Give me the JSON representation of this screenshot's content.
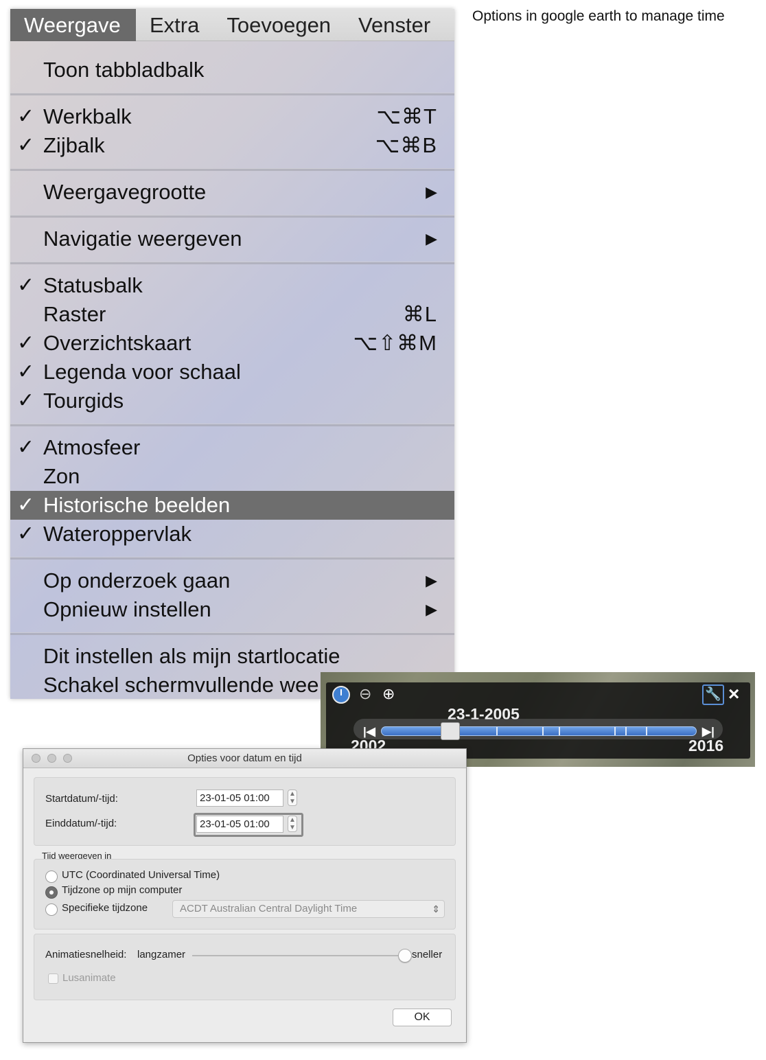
{
  "caption": "Options in google earth to manage time",
  "menubar": {
    "items": [
      "Weergave",
      "Extra",
      "Toevoegen",
      "Venster"
    ],
    "active_index": 0
  },
  "menu": {
    "check_glyph": "✓",
    "submenu_glyph": "▶",
    "items": [
      {
        "label": "Toon tabbladbalk",
        "checked": false,
        "shortcut": "",
        "submenu": false
      },
      {
        "label": "Werkbalk",
        "checked": true,
        "shortcut": "⌥⌘T",
        "submenu": false
      },
      {
        "label": "Zijbalk",
        "checked": true,
        "shortcut": "⌥⌘B",
        "submenu": false
      },
      {
        "label": "Weergavegrootte",
        "checked": false,
        "shortcut": "",
        "submenu": true
      },
      {
        "label": "Navigatie weergeven",
        "checked": false,
        "shortcut": "",
        "submenu": true
      },
      {
        "label": "Statusbalk",
        "checked": true,
        "shortcut": "",
        "submenu": false
      },
      {
        "label": "Raster",
        "checked": false,
        "shortcut": "⌘L",
        "submenu": false
      },
      {
        "label": "Overzichtskaart",
        "checked": true,
        "shortcut": "⌥⇧⌘M",
        "submenu": false
      },
      {
        "label": "Legenda voor schaal",
        "checked": true,
        "shortcut": "",
        "submenu": false
      },
      {
        "label": "Tourgids",
        "checked": true,
        "shortcut": "",
        "submenu": false
      },
      {
        "label": "Atmosfeer",
        "checked": true,
        "shortcut": "",
        "submenu": false
      },
      {
        "label": "Zon",
        "checked": false,
        "shortcut": "",
        "submenu": false
      },
      {
        "label": "Historische beelden",
        "checked": true,
        "shortcut": "",
        "submenu": false,
        "selected": true
      },
      {
        "label": "Wateroppervlak",
        "checked": true,
        "shortcut": "",
        "submenu": false
      },
      {
        "label": "Op onderzoek gaan",
        "checked": false,
        "shortcut": "",
        "submenu": true
      },
      {
        "label": "Opnieuw instellen",
        "checked": false,
        "shortcut": "",
        "submenu": true
      },
      {
        "label": "Dit instellen als mijn startlocatie",
        "checked": false,
        "shortcut": "",
        "submenu": false
      },
      {
        "label": "Schakel schermvullende wee",
        "checked": false,
        "shortcut": "",
        "submenu": false
      }
    ]
  },
  "timeline": {
    "current_date": "23-1-2005",
    "start_year": "2002",
    "end_year": "2016",
    "position_fraction": 0.22,
    "icons": {
      "clock": "clock-icon",
      "zoom_out": "zoom-out-icon",
      "zoom_in": "zoom-in-icon",
      "settings": "wrench-icon",
      "close": "close-icon",
      "prev": "skip-back-icon",
      "next": "skip-forward-icon"
    },
    "zoom_out_glyph": "⊖",
    "zoom_in_glyph": "⊕",
    "wrench_glyph": "🔧",
    "close_glyph": "×",
    "prev_glyph": "|◀",
    "next_glyph": "▶|"
  },
  "dialog": {
    "title": "Opties voor datum en tijd",
    "start_label": "Startdatum/-tijd:",
    "start_value": "23-01-05 01:00",
    "end_label": "Einddatum/-tijd:",
    "end_value": "23-01-05 01:00",
    "timezone_group_label": "Tijd weergeven in",
    "radio_utc": "UTC (Coordinated Universal Time)",
    "radio_local": "Tijdzone op mijn computer",
    "radio_specific": "Specifieke tijdzone",
    "selected_radio": "local",
    "timezone_select": "ACDT Australian Central Daylight Time",
    "speed_label": "Animatiesnelheid:",
    "slower_label": "langzamer",
    "faster_label": "sneller",
    "speed_fraction": 1.0,
    "loop_label": "Lusanimate",
    "ok_label": "OK",
    "colors": {
      "focus": "#8a8a8a",
      "selected_radio": "#6f6f6f"
    }
  }
}
